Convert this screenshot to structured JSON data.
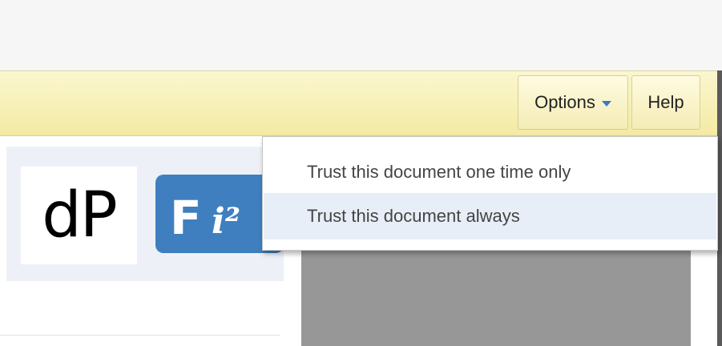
{
  "toolbar": {
    "options_label": "Options",
    "help_label": "Help"
  },
  "dropdown": {
    "items": [
      {
        "label": "Trust this document one time only"
      },
      {
        "label": "Trust this document always",
        "highlighted": true
      }
    ]
  },
  "logos": {
    "dp_text": "dP",
    "fi_text": "F",
    "fi_superscript": "i²"
  },
  "colors": {
    "notification_bar": "#f5eeb3",
    "logo_blue": "#3f7fbf",
    "highlight": "#e8eef7",
    "gray_preview": "#979797"
  }
}
